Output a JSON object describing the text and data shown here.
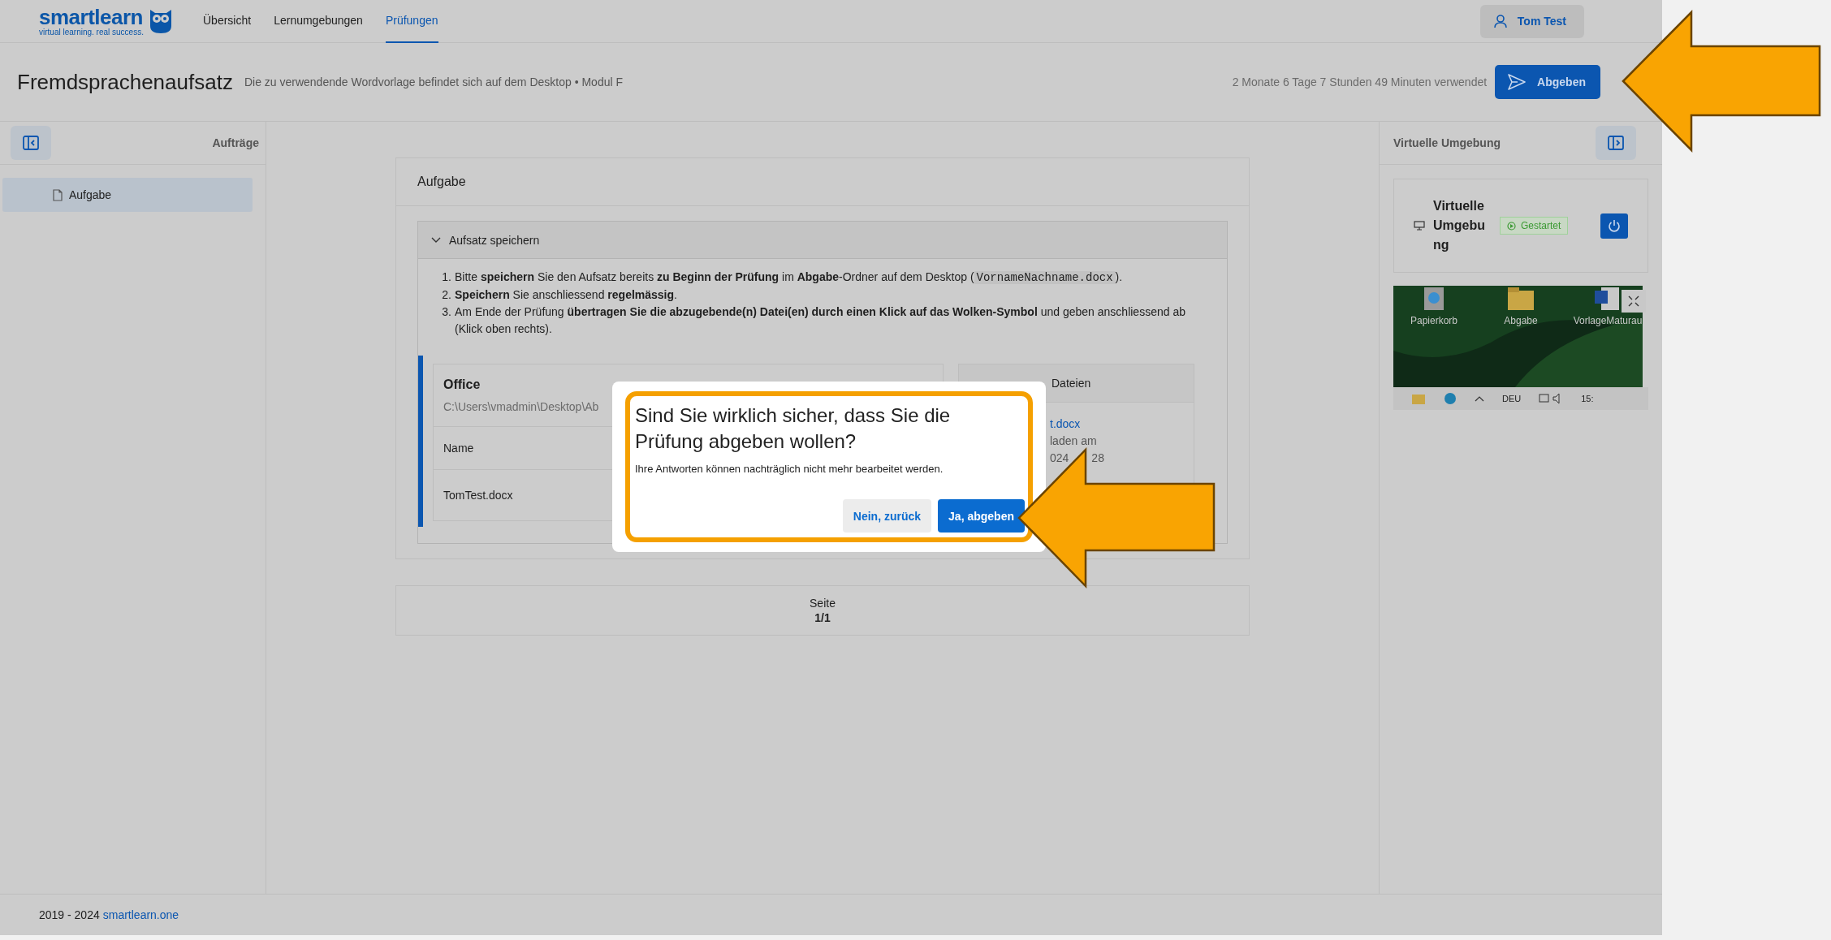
{
  "header": {
    "logo": {
      "name": "smartlearn",
      "tagline": "virtual learning. real success."
    },
    "nav": [
      {
        "label": "Übersicht",
        "selected": false
      },
      {
        "label": "Lernumgebungen",
        "selected": false
      },
      {
        "label": "Prüfungen",
        "selected": true
      }
    ],
    "user": "Tom Test"
  },
  "exam": {
    "title": "Fremdsprachenaufsatz",
    "subtitle": "Die zu verwendende Wordvorlage befindet sich auf dem Desktop • Modul F",
    "time_used": "2 Monate 6 Tage 7 Stunden 49 Minuten verwendet",
    "submit": "Abgeben"
  },
  "sidebar": {
    "title": "Aufträge",
    "items": [
      {
        "label": "Aufgabe",
        "selected": true
      }
    ]
  },
  "task": {
    "title": "Aufgabe",
    "section": {
      "title": "Aufsatz speichern",
      "expanded": true,
      "instructions": [
        {
          "number": "1.",
          "parts": [
            {
              "kind": "text",
              "text": "Bitte **speichern** Sie den Aufsatz bereits **zu Beginn der Prüfung** im **Abgabe**-Ordner auf dem Desktop ("
            },
            {
              "kind": "code",
              "text": "VornameNachname.docx"
            },
            {
              "kind": "text",
              "text": ")."
            }
          ]
        },
        {
          "number": "2.",
          "parts": [
            {
              "kind": "text",
              "text": "**Speichern** Sie anschliessend **regelmässig**."
            }
          ]
        },
        {
          "number": "3.",
          "parts": [
            {
              "kind": "text",
              "text": "Am Ende der Prüfung **übertragen Sie die abzugebende(n) Datei(en) durch einen Klick auf das Wolken-Symbol** und geben anschliessend ab (Klick oben rechts)."
            }
          ]
        }
      ],
      "office": {
        "title": "Office",
        "path": "C:\\Users\\vmadmin\\Desktop\\Ab",
        "column": "Name",
        "file": "TomTest.docx"
      },
      "uploads": {
        "title": "Dateien",
        "file": "t.docx",
        "line_1": "laden am",
        "line_2": "024",
        "line_2_end": "28"
      }
    }
  },
  "pagination": {
    "label": "Seite",
    "value": "1/1"
  },
  "environment": {
    "title": "Virtuelle Umgebung",
    "name": "Virtuelle Umgebung",
    "status": "Gestartet",
    "desktop": {
      "icons": [
        {
          "kind": "recycle",
          "label": "Papierkorb"
        },
        {
          "kind": "folder",
          "label": "Abgabe"
        },
        {
          "kind": "word",
          "label": "VorlageMaturau"
        }
      ],
      "language": "DEU",
      "clock": "15:"
    }
  },
  "footer": {
    "text": "2019 - 2024",
    "link": "smartlearn.one"
  },
  "dialog": {
    "title": "Sind Sie wirklich sicher, dass Sie die Prüfung abgeben wollen?",
    "message": "Ihre Antworten können nachträglich nicht mehr bearbeitet werden.",
    "buttons": [
      {
        "label": "Nein, zurück",
        "kind": "secondary"
      },
      {
        "label": "Ja, abgeben",
        "kind": "primary"
      }
    ]
  }
}
